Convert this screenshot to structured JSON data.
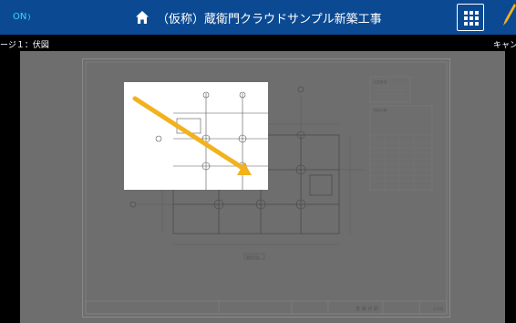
{
  "header": {
    "status_on": "ON",
    "title": "（仮称）蔵衛門クラウドサンプル新築工事"
  },
  "subbar": {
    "page_label": "ージ１：伏図",
    "cancel_label": "キャン"
  },
  "drawing": {
    "plan_title": "基礎伏図",
    "notes_title": "注意事項",
    "table_title": "特記仕様",
    "title_block_name": "基 礎 伏 図",
    "scale": "1/100"
  },
  "colors": {
    "header_bg": "#0b4a93",
    "annotation_arrow": "#f2b21e",
    "on_badge": "#3fd2ff"
  },
  "icons": [
    "home-icon",
    "grid-menu-icon",
    "pencil-icon",
    "wifi-icon"
  ]
}
